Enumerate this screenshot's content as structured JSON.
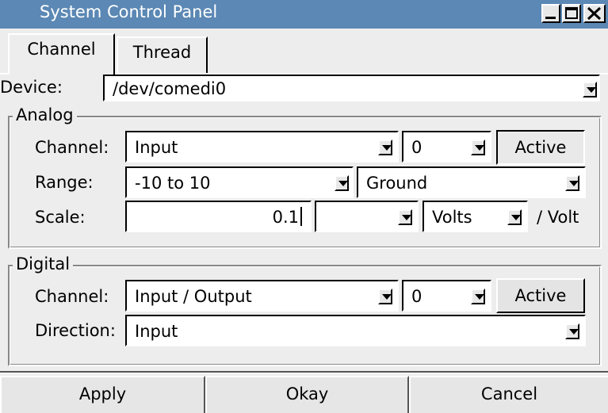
{
  "window": {
    "title": "System Control Panel"
  },
  "tabs": [
    {
      "label": "Channel",
      "active": true
    },
    {
      "label": "Thread",
      "active": false
    }
  ],
  "device": {
    "label": "Device:",
    "value": "/dev/comedi0"
  },
  "analog": {
    "title": "Analog",
    "channel_label": "Channel:",
    "channel_type": "Input",
    "channel_number": "0",
    "active_label": "Active",
    "range_label": "Range:",
    "range_value": "-10 to 10",
    "reference_value": "Ground",
    "scale_label": "Scale:",
    "scale_value": "0.1",
    "scale_prefix": "",
    "scale_unit": "Volts",
    "scale_suffix": "/ Volt"
  },
  "digital": {
    "title": "Digital",
    "channel_label": "Channel:",
    "channel_type": "Input / Output",
    "channel_number": "0",
    "active_label": "Active",
    "direction_label": "Direction:",
    "direction_value": "Input"
  },
  "buttons": {
    "apply": "Apply",
    "okay": "Okay",
    "cancel": "Cancel"
  },
  "colors": {
    "titlebar": "#5b88b4",
    "background": "#ededed"
  }
}
